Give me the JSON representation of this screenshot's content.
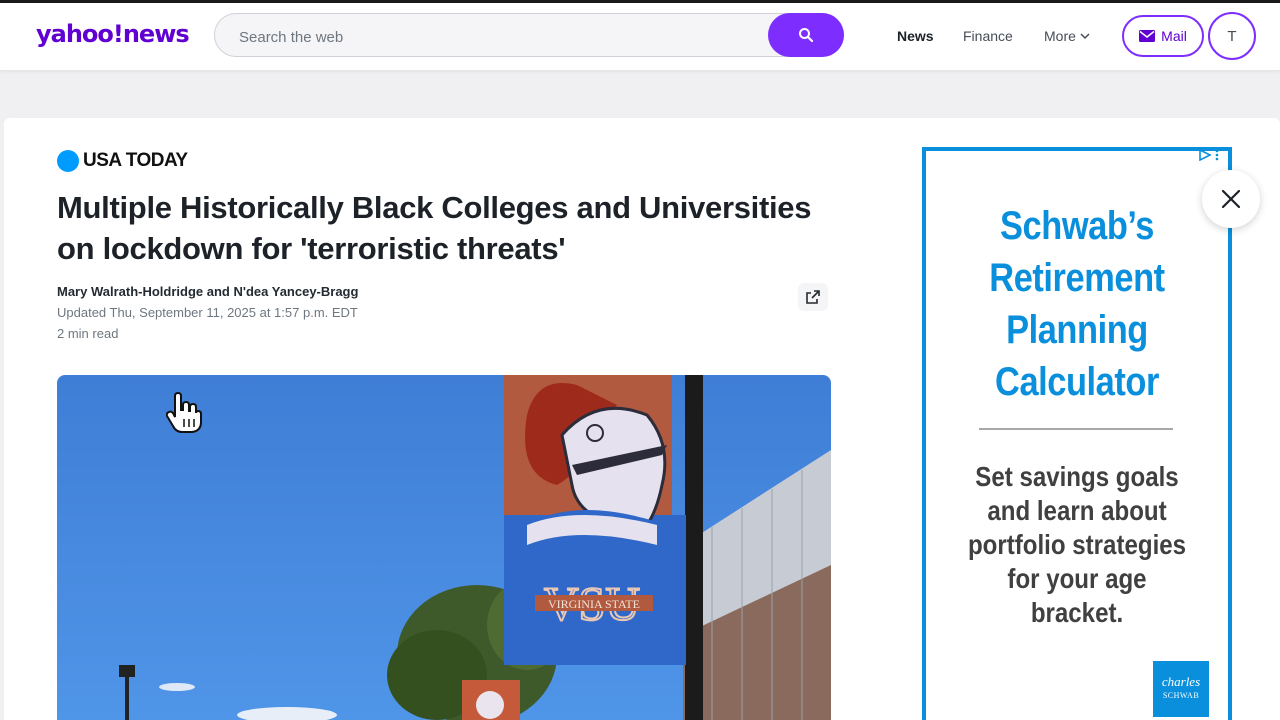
{
  "header": {
    "logo": "yahoo!news",
    "search": {
      "placeholder": "Search the web",
      "value": ""
    },
    "nav": {
      "news": "News",
      "finance": "Finance",
      "more": "More"
    },
    "mail_label": "Mail",
    "avatar_initial": "T"
  },
  "article": {
    "publisher": "USA TODAY",
    "headline": "Multiple Historically Black Colleges and Universities on lockdown for 'terroristic threats'",
    "byline": "Mary Walrath-Holdridge and N'dea Yancey-Bragg",
    "updated": "Updated Thu, September 11, 2025 at 1:57 p.m. EDT",
    "read_time": "2 min read",
    "photo": {
      "banner_text": "VSU",
      "banner_subtext": "VIRGINIA STATE"
    }
  },
  "ad": {
    "headline_lines": [
      "Schwab’s",
      "Retirement",
      "Planning",
      "Calculator"
    ],
    "body_lines": [
      "Set savings goals",
      "and learn about",
      "portfolio strategies",
      "for your age bracket."
    ],
    "logo_line1": "charles",
    "logo_line2": "SCHWAB"
  },
  "colors": {
    "brand_purple": "#6001d2",
    "accent_purple": "#7d2eff",
    "ad_blue": "#0a8fdc",
    "publisher_blue": "#009bff"
  },
  "icons": [
    "search-icon",
    "chevron-down-icon",
    "mail-icon",
    "share-icon",
    "close-icon",
    "ad-choices-icon",
    "hand-cursor-icon"
  ]
}
